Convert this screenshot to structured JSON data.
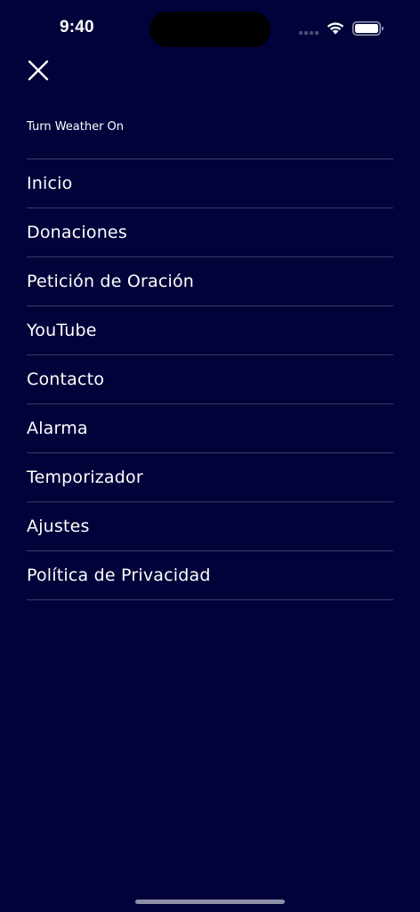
{
  "status_bar": {
    "time": "9:40",
    "icons": [
      "cellular-signal-icon",
      "wifi-icon",
      "battery-icon"
    ]
  },
  "header": {
    "close_icon": "close-icon",
    "weather_toggle_label": "Turn Weather On"
  },
  "menu": {
    "items": [
      {
        "label": "Inicio"
      },
      {
        "label": "Donaciones"
      },
      {
        "label": "Petición de Oración"
      },
      {
        "label": "YouTube"
      },
      {
        "label": "Contacto"
      },
      {
        "label": "Alarma"
      },
      {
        "label": "Temporizador"
      },
      {
        "label": "Ajustes"
      },
      {
        "label": "Política de Privacidad"
      }
    ]
  },
  "colors": {
    "background": "#01023a",
    "text": "#ffffff",
    "divider": "#3a3c66"
  }
}
